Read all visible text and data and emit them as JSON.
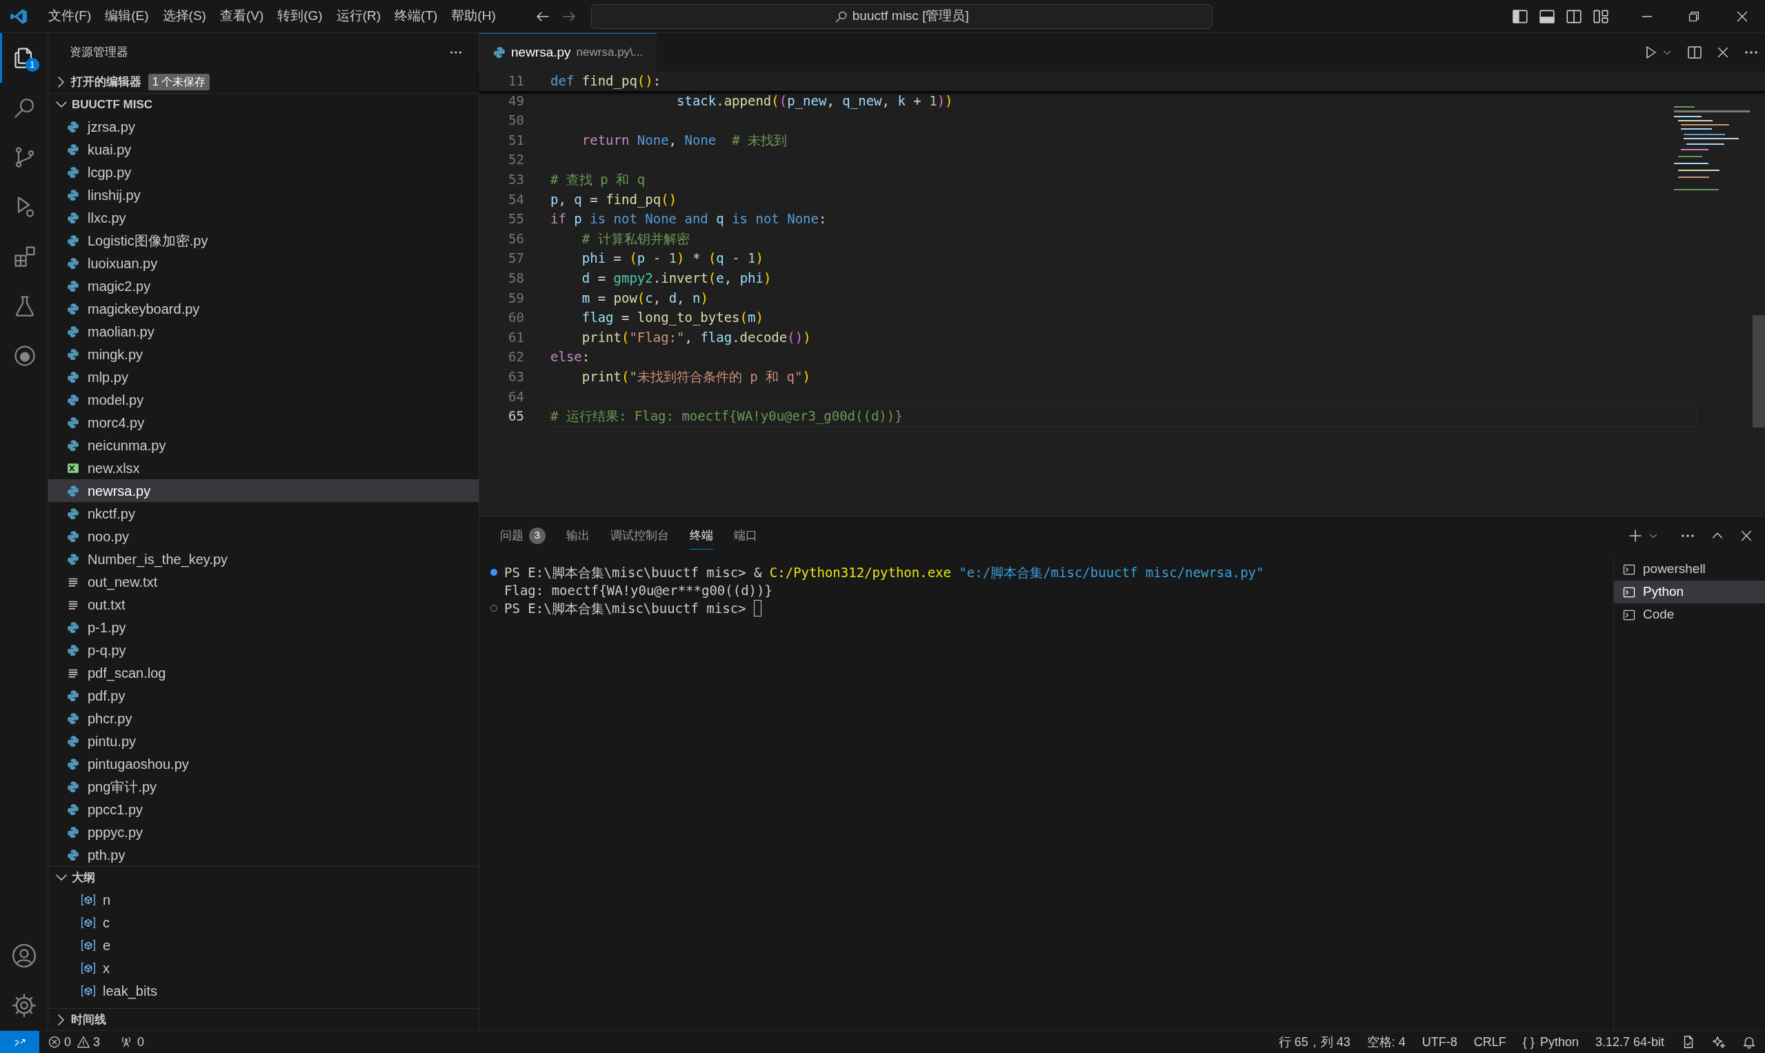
{
  "title_bar": {
    "menus": [
      "文件(F)",
      "编辑(E)",
      "选择(S)",
      "查看(V)",
      "转到(G)",
      "运行(R)",
      "终端(T)",
      "帮助(H)"
    ],
    "search": "buuctf misc [管理员]",
    "layout_toggles": [
      {
        "kind": "primary_sidebar",
        "on": true
      },
      {
        "kind": "panel",
        "on": true
      },
      {
        "kind": "secondary_sidebar",
        "on": false
      },
      {
        "kind": "customize",
        "on": false
      }
    ]
  },
  "activity_bar": {
    "items": [
      {
        "kind": "files",
        "selected": true,
        "badge": "1"
      },
      {
        "kind": "search",
        "selected": false
      },
      {
        "kind": "source_control",
        "selected": false
      },
      {
        "kind": "run_debug",
        "selected": false
      },
      {
        "kind": "extensions",
        "selected": false
      },
      {
        "kind": "testing",
        "selected": false
      },
      {
        "kind": "round",
        "selected": false
      }
    ],
    "bottom": [
      {
        "kind": "account"
      },
      {
        "kind": "settings"
      }
    ]
  },
  "sidebar": {
    "title": "资源管理器",
    "open_editors": {
      "label": "打开的编辑器",
      "badge": "1 个未保存",
      "expanded": false
    },
    "folder": {
      "label": "BUUCTF MISC",
      "expanded": true,
      "files": [
        {
          "name": "jzrsa.py",
          "kind": "python",
          "selected": false
        },
        {
          "name": "kuai.py",
          "kind": "python",
          "selected": false
        },
        {
          "name": "lcgp.py",
          "kind": "python",
          "selected": false
        },
        {
          "name": "linshij.py",
          "kind": "python",
          "selected": false
        },
        {
          "name": "llxc.py",
          "kind": "python",
          "selected": false
        },
        {
          "name": "Logistic图像加密.py",
          "kind": "python",
          "selected": false
        },
        {
          "name": "luoixuan.py",
          "kind": "python",
          "selected": false
        },
        {
          "name": "magic2.py",
          "kind": "python",
          "selected": false
        },
        {
          "name": "magickeyboard.py",
          "kind": "python",
          "selected": false
        },
        {
          "name": "maolian.py",
          "kind": "python",
          "selected": false
        },
        {
          "name": "mingk.py",
          "kind": "python",
          "selected": false
        },
        {
          "name": "mlp.py",
          "kind": "python",
          "selected": false
        },
        {
          "name": "model.py",
          "kind": "python",
          "selected": false
        },
        {
          "name": "morc4.py",
          "kind": "python",
          "selected": false
        },
        {
          "name": "neicunma.py",
          "kind": "python",
          "selected": false
        },
        {
          "name": "new.xlsx",
          "kind": "spreadsheet",
          "selected": false
        },
        {
          "name": "newrsa.py",
          "kind": "python",
          "selected": true
        },
        {
          "name": "nkctf.py",
          "kind": "python",
          "selected": false
        },
        {
          "name": "noo.py",
          "kind": "python",
          "selected": false
        },
        {
          "name": "Number_is_the_key.py",
          "kind": "python",
          "selected": false
        },
        {
          "name": "out_new.txt",
          "kind": "text",
          "selected": false
        },
        {
          "name": "out.txt",
          "kind": "text",
          "selected": false
        },
        {
          "name": "p-1.py",
          "kind": "python",
          "selected": false
        },
        {
          "name": "p-q.py",
          "kind": "python",
          "selected": false
        },
        {
          "name": "pdf_scan.log",
          "kind": "text",
          "selected": false
        },
        {
          "name": "pdf.py",
          "kind": "python",
          "selected": false
        },
        {
          "name": "phcr.py",
          "kind": "python",
          "selected": false
        },
        {
          "name": "pintu.py",
          "kind": "python",
          "selected": false
        },
        {
          "name": "pintugaoshou.py",
          "kind": "python",
          "selected": false
        },
        {
          "name": "png审计.py",
          "kind": "python",
          "selected": false
        },
        {
          "name": "ppcc1.py",
          "kind": "python",
          "selected": false
        },
        {
          "name": "pppyc.py",
          "kind": "python",
          "selected": false
        },
        {
          "name": "pth.py",
          "kind": "python",
          "selected": false
        }
      ]
    },
    "outline": {
      "label": "大纲",
      "expanded": true,
      "items": [
        {
          "name": "n"
        },
        {
          "name": "c"
        },
        {
          "name": "e"
        },
        {
          "name": "x"
        },
        {
          "name": "leak_bits"
        }
      ]
    },
    "timeline": {
      "label": "时间线",
      "expanded": false
    }
  },
  "editor": {
    "tabs": [
      {
        "label": "newrsa.py",
        "description": "newrsa.py\\...",
        "selected": true
      }
    ],
    "sticky": {
      "number": "11",
      "tokens": [
        {
          "text": "def ",
          "kind": "storage"
        },
        {
          "text": "find_pq",
          "kind": "func"
        },
        {
          "text": "(",
          "kind": "b1"
        },
        {
          "text": ")",
          "kind": "b1"
        },
        {
          "text": ":",
          "kind": "plain"
        }
      ]
    },
    "lines": [
      {
        "number": "49",
        "current": false,
        "tokens": [
          {
            "text": "                stack",
            "kind": "var"
          },
          {
            "text": ".",
            "kind": "plain"
          },
          {
            "text": "append",
            "kind": "func"
          },
          {
            "text": "(",
            "kind": "b1"
          },
          {
            "text": "(",
            "kind": "b2"
          },
          {
            "text": "p_new",
            "kind": "var"
          },
          {
            "text": ", ",
            "kind": "plain"
          },
          {
            "text": "q_new",
            "kind": "var"
          },
          {
            "text": ", ",
            "kind": "plain"
          },
          {
            "text": "k",
            "kind": "var"
          },
          {
            "text": " + ",
            "kind": "plain"
          },
          {
            "text": "1",
            "kind": "num"
          },
          {
            "text": ")",
            "kind": "b2"
          },
          {
            "text": ")",
            "kind": "b1"
          }
        ]
      },
      {
        "number": "50",
        "current": false
      },
      {
        "number": "51",
        "current": false,
        "tokens": [
          {
            "text": "    return ",
            "kind": "control"
          },
          {
            "text": "None",
            "kind": "storage"
          },
          {
            "text": ", ",
            "kind": "plain"
          },
          {
            "text": "None",
            "kind": "storage"
          },
          {
            "text": "  # 未找到",
            "kind": "comment"
          }
        ]
      },
      {
        "number": "52",
        "current": false
      },
      {
        "number": "53",
        "current": false,
        "tokens": [
          {
            "text": "# 查找 p 和 q",
            "kind": "comment"
          }
        ]
      },
      {
        "number": "54",
        "current": false,
        "tokens": [
          {
            "text": "p",
            "kind": "var"
          },
          {
            "text": ", ",
            "kind": "plain"
          },
          {
            "text": "q",
            "kind": "var"
          },
          {
            "text": " = ",
            "kind": "plain"
          },
          {
            "text": "find_pq",
            "kind": "func"
          },
          {
            "text": "(",
            "kind": "b1"
          },
          {
            "text": ")",
            "kind": "b1"
          }
        ]
      },
      {
        "number": "55",
        "current": false,
        "tokens": [
          {
            "text": "if ",
            "kind": "control"
          },
          {
            "text": "p",
            "kind": "var"
          },
          {
            "text": " is not None and ",
            "kind": "storage"
          },
          {
            "text": "q",
            "kind": "var"
          },
          {
            "text": " is not None",
            "kind": "storage"
          },
          {
            "text": ":",
            "kind": "plain"
          }
        ]
      },
      {
        "number": "56",
        "current": false,
        "tokens": [
          {
            "text": "    # 计算私钥并解密",
            "kind": "comment"
          }
        ]
      },
      {
        "number": "57",
        "current": false,
        "tokens": [
          {
            "text": "    phi",
            "kind": "var"
          },
          {
            "text": " = ",
            "kind": "plain"
          },
          {
            "text": "(",
            "kind": "b1"
          },
          {
            "text": "p",
            "kind": "var"
          },
          {
            "text": " - ",
            "kind": "plain"
          },
          {
            "text": "1",
            "kind": "num"
          },
          {
            "text": ")",
            "kind": "b1"
          },
          {
            "text": " * ",
            "kind": "plain"
          },
          {
            "text": "(",
            "kind": "b1"
          },
          {
            "text": "q",
            "kind": "var"
          },
          {
            "text": " - ",
            "kind": "plain"
          },
          {
            "text": "1",
            "kind": "num"
          },
          {
            "text": ")",
            "kind": "b1"
          }
        ]
      },
      {
        "number": "58",
        "current": false,
        "tokens": [
          {
            "text": "    d",
            "kind": "var"
          },
          {
            "text": " = ",
            "kind": "plain"
          },
          {
            "text": "gmpy2",
            "kind": "module"
          },
          {
            "text": ".",
            "kind": "plain"
          },
          {
            "text": "invert",
            "kind": "func"
          },
          {
            "text": "(",
            "kind": "b1"
          },
          {
            "text": "e",
            "kind": "var"
          },
          {
            "text": ", ",
            "kind": "plain"
          },
          {
            "text": "phi",
            "kind": "var"
          },
          {
            "text": ")",
            "kind": "b1"
          }
        ]
      },
      {
        "number": "59",
        "current": false,
        "tokens": [
          {
            "text": "    m",
            "kind": "var"
          },
          {
            "text": " = ",
            "kind": "plain"
          },
          {
            "text": "pow",
            "kind": "func"
          },
          {
            "text": "(",
            "kind": "b1"
          },
          {
            "text": "c",
            "kind": "var"
          },
          {
            "text": ", ",
            "kind": "plain"
          },
          {
            "text": "d",
            "kind": "var"
          },
          {
            "text": ", ",
            "kind": "plain"
          },
          {
            "text": "n",
            "kind": "var"
          },
          {
            "text": ")",
            "kind": "b1"
          }
        ]
      },
      {
        "number": "60",
        "current": false,
        "tokens": [
          {
            "text": "    flag",
            "kind": "var"
          },
          {
            "text": " = ",
            "kind": "plain"
          },
          {
            "text": "long_to_bytes",
            "kind": "func"
          },
          {
            "text": "(",
            "kind": "b1"
          },
          {
            "text": "m",
            "kind": "var"
          },
          {
            "text": ")",
            "kind": "b1"
          }
        ]
      },
      {
        "number": "61",
        "current": false,
        "tokens": [
          {
            "text": "    print",
            "kind": "func"
          },
          {
            "text": "(",
            "kind": "b1"
          },
          {
            "text": "\"Flag:\"",
            "kind": "str"
          },
          {
            "text": ", ",
            "kind": "plain"
          },
          {
            "text": "flag",
            "kind": "var"
          },
          {
            "text": ".",
            "kind": "plain"
          },
          {
            "text": "decode",
            "kind": "func"
          },
          {
            "text": "(",
            "kind": "b2"
          },
          {
            "text": ")",
            "kind": "b2"
          },
          {
            "text": ")",
            "kind": "b1"
          }
        ]
      },
      {
        "number": "62",
        "current": false,
        "tokens": [
          {
            "text": "else",
            "kind": "control"
          },
          {
            "text": ":",
            "kind": "plain"
          }
        ]
      },
      {
        "number": "63",
        "current": false,
        "tokens": [
          {
            "text": "    print",
            "kind": "func"
          },
          {
            "text": "(",
            "kind": "b1"
          },
          {
            "text": "\"未找到符合条件的 p 和 q\"",
            "kind": "str"
          },
          {
            "text": ")",
            "kind": "b1"
          }
        ]
      },
      {
        "number": "64",
        "current": false
      },
      {
        "number": "65",
        "current": true,
        "tokens": [
          {
            "text": "# 运行结果: Flag: moectf{WA!y0u@er3_g00d((d))}",
            "kind": "comment"
          }
        ]
      }
    ]
  },
  "panel": {
    "tabs": [
      {
        "label": "问题",
        "badge": "3",
        "selected": false
      },
      {
        "label": "输出",
        "selected": false
      },
      {
        "label": "调试控制台",
        "selected": false
      },
      {
        "label": "终端",
        "selected": true
      },
      {
        "label": "端口",
        "selected": false
      }
    ],
    "terminal_lines": [
      {
        "kind": "finished",
        "segments": [
          {
            "text": "PS E:\\脚本合集\\misc\\buuctf misc> & ",
            "kind": "plain"
          },
          {
            "text": "C:/Python312/python.exe",
            "kind": "command"
          },
          {
            "text": " \"e:/脚本合集/misc/buuctf misc/newrsa.py\"",
            "kind": "string"
          }
        ]
      },
      {
        "kind": "output",
        "segments": [
          {
            "text": "Flag: moectf{WA!y0u@er***g00((d))}",
            "kind": "plain"
          }
        ]
      },
      {
        "kind": "prompt",
        "segments": [
          {
            "text": "PS E:\\脚本合集\\misc\\buuctf misc>",
            "kind": "plain"
          }
        ],
        "cursor": true
      }
    ],
    "terminals": [
      {
        "label": "powershell",
        "selected": false
      },
      {
        "label": "Python",
        "selected": true
      },
      {
        "label": "Code",
        "selected": false
      }
    ]
  },
  "status_bar": {
    "errors": "0",
    "warnings": "3",
    "ports": "0",
    "items": [
      {
        "text": "行 65，列 43"
      },
      {
        "text": "空格: 4"
      },
      {
        "text": "UTF-8"
      },
      {
        "text": "CRLF"
      },
      {
        "prefix": "{ }",
        "text": "Python"
      },
      {
        "text": "3.12.7 64-bit"
      }
    ]
  }
}
